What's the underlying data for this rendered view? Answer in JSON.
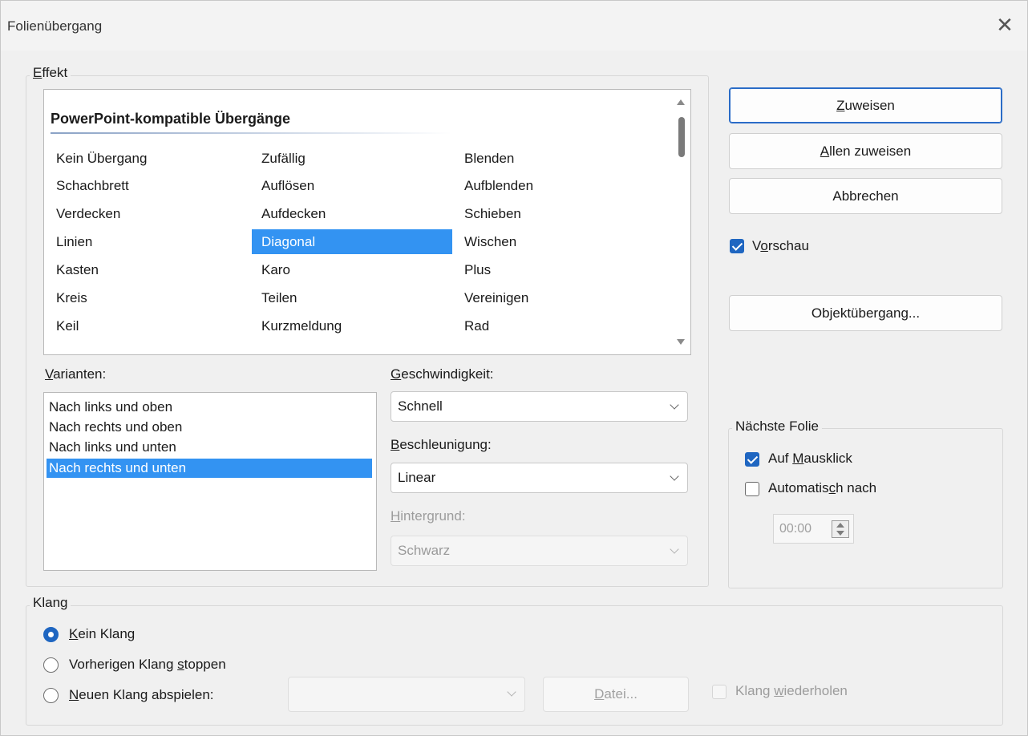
{
  "window": {
    "title": "Folienübergang"
  },
  "effect": {
    "group_label_first": "E",
    "group_label_rest": "ffekt",
    "list_heading": "PowerPoint-kompatible Übergänge",
    "columns": [
      [
        "Kein Übergang",
        "Schachbrett",
        "Verdecken",
        "Linien",
        "Kasten",
        "Kreis",
        "Keil"
      ],
      [
        "Zufällig",
        "Auflösen",
        "Aufdecken",
        "Diagonal",
        "Karo",
        "Teilen",
        "Kurzmeldung"
      ],
      [
        "Blenden",
        "Aufblenden",
        "Schieben",
        "Wischen",
        "Plus",
        "Vereinigen",
        "Rad"
      ]
    ],
    "selected": "Diagonal",
    "variants_label_first": "V",
    "variants_label_rest": "arianten:",
    "variants": [
      "Nach links und oben",
      "Nach rechts und oben",
      "Nach links und unten",
      "Nach rechts und unten"
    ],
    "selected_variant": "Nach rechts und unten",
    "speed_label_first": "G",
    "speed_label_rest": "eschwindigkeit:",
    "speed_value": "Schnell",
    "accel_label_first": "B",
    "accel_label_rest": "eschleunigung:",
    "accel_value": "Linear",
    "background_label_first": "H",
    "background_label_rest": "intergrund:",
    "background_value": "Schwarz"
  },
  "buttons": {
    "apply_first": "Z",
    "apply_rest": "uweisen",
    "apply_all_first": "A",
    "apply_all_rest": "llen zuweisen",
    "cancel": "Abbrechen",
    "object_transition": "Objektübergang..."
  },
  "preview": {
    "label_a": "V",
    "label_u": "o",
    "label_b": "rschau",
    "checked": true
  },
  "next_slide": {
    "group_label": "Nächste Folie",
    "on_click_a": "Auf ",
    "on_click_u": "M",
    "on_click_b": "ausklick",
    "on_click_checked": true,
    "auto_a": "Automatis",
    "auto_u": "c",
    "auto_b": "h nach",
    "auto_checked": false,
    "auto_time": "00:00"
  },
  "sound": {
    "group_label": "Klang",
    "no_sound_u": "K",
    "no_sound_rest": "ein Klang",
    "stop_a": "Vorherigen Klang ",
    "stop_u": "s",
    "stop_b": "toppen",
    "play_u": "N",
    "play_rest": "euen Klang abspielen:",
    "selected": "Kein Klang",
    "file_u": "D",
    "file_rest": "atei...",
    "repeat_a": "Klang ",
    "repeat_u": "w",
    "repeat_b": "iederholen"
  },
  "colors": {
    "accent": "#1f66c1",
    "selection": "#3393f2"
  }
}
